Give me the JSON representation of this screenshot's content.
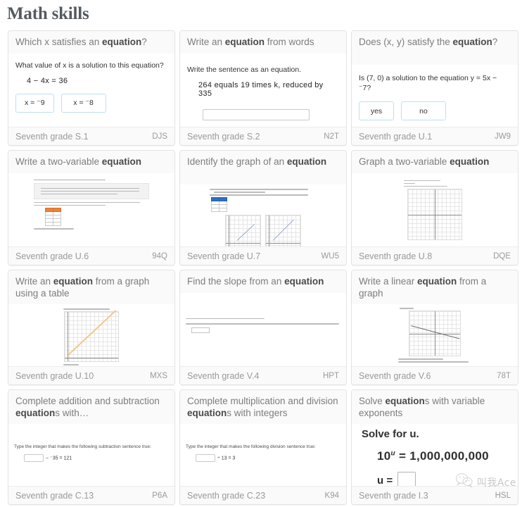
{
  "page": {
    "title": "Math skills"
  },
  "watermark": {
    "text": "叫我Ace",
    "icon": "wechat-logo-icon"
  },
  "cards": [
    {
      "title_pre": "Which x satisfies an ",
      "title_bold": "equation",
      "title_post": "?",
      "grade": "Seventh grade S.1",
      "code": "DJS",
      "preview": {
        "question": "What value of x is a solution to this equation?",
        "equation": "4 − 4x = 36",
        "choices": [
          "x = ⁻9",
          "x = ⁻8"
        ]
      }
    },
    {
      "title_pre": "Write an ",
      "title_bold": "equation",
      "title_post": " from words",
      "grade": "Seventh grade S.2",
      "code": "N2T",
      "preview": {
        "question": "Write the sentence as an equation.",
        "sentence": "264 equals 19 times k, reduced by 335"
      }
    },
    {
      "title_pre": "Does (x, y) satisfy the ",
      "title_bold": "equation",
      "title_post": "?",
      "grade": "Seventh grade U.1",
      "code": "JW9",
      "preview": {
        "question": "Is (7, 0) a solution to the equation y = 5x − ⁻7?",
        "choices": [
          "yes",
          "no"
        ]
      }
    },
    {
      "title_pre": "Write a two-variable ",
      "title_bold": "equation",
      "title_post": "",
      "grade": "Seventh grade U.6",
      "code": "94Q",
      "preview": {
        "thumbnail": "word-problem-with-orange-table"
      }
    },
    {
      "title_pre": "Identify the graph of an ",
      "title_bold": "equation",
      "title_post": "",
      "grade": "Seventh grade U.7",
      "code": "WU5",
      "preview": {
        "thumbnail": "blue-table-with-two-line-graphs"
      }
    },
    {
      "title_pre": "Graph a two-variable ",
      "title_bold": "equation",
      "title_post": "",
      "grade": "Seventh grade U.8",
      "code": "DQE",
      "preview": {
        "thumbnail": "empty-coordinate-grid"
      }
    },
    {
      "title_pre": "Write an ",
      "title_bold": "equation",
      "title_post": " from a graph using a table",
      "grade": "Seventh grade U.10",
      "code": "MXS",
      "preview": {
        "thumbnail": "orange-rising-line-graph"
      }
    },
    {
      "title_pre": "Find the slope from an ",
      "title_bold": "equation",
      "title_post": "",
      "grade": "Seventh grade V.4",
      "code": "HPT",
      "preview": {
        "thumbnail": "slope-question-with-fraction"
      }
    },
    {
      "title_pre": "Write a linear ",
      "title_bold": "equation",
      "title_post": " from a graph",
      "grade": "Seventh grade V.6",
      "code": "78T",
      "preview": {
        "thumbnail": "gray-falling-line-graph"
      }
    },
    {
      "title_pre": "Complete addition and subtraction ",
      "title_bold": "equation",
      "title_post": "s with…",
      "grade": "Seventh grade C.13",
      "code": "P6A",
      "preview": {
        "question": "Type the integer that makes the following subtraction sentence true:",
        "equation_suffix": "− ⁻35 = 121"
      }
    },
    {
      "title_pre": "Complete multiplication and division ",
      "title_bold": "equation",
      "title_post": "s with integers",
      "grade": "Seventh grade C.23",
      "code": "K94",
      "preview": {
        "question": "Type the integer that makes the following division sentence true:",
        "equation_suffix": "÷ 13 = 3"
      }
    },
    {
      "title_pre": "Solve ",
      "title_bold": "equation",
      "title_post": "s with variable exponents",
      "grade": "Seventh grade I.3",
      "code": "HSL",
      "preview": {
        "prompt": "Solve for u.",
        "base": "10",
        "exponent": "u",
        "result": "= 1,000,000,000",
        "answer_label": "u ="
      }
    }
  ]
}
